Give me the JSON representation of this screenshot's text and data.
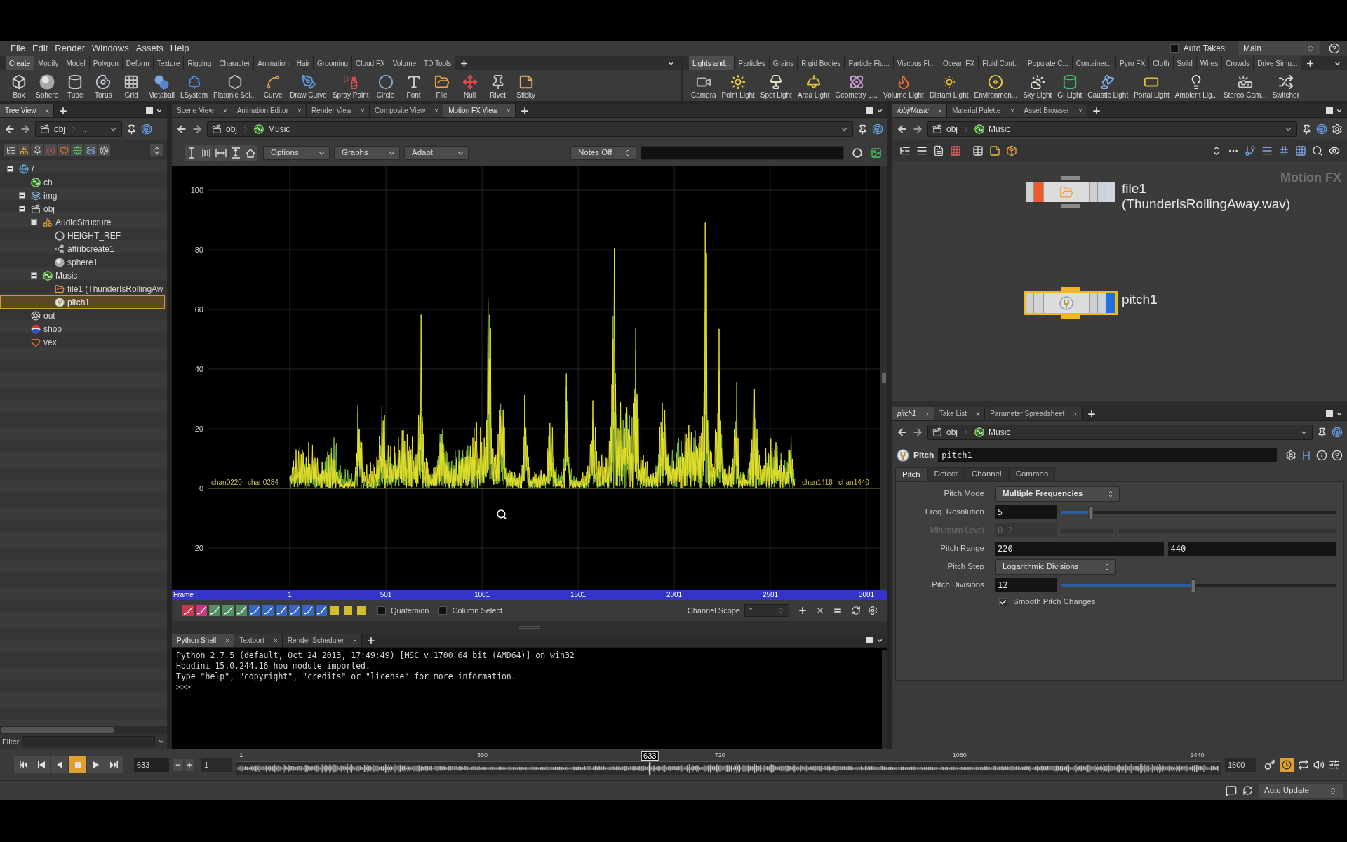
{
  "menu_bar": {
    "items": [
      "File",
      "Edit",
      "Render",
      "Windows",
      "Assets",
      "Help"
    ],
    "auto_takes": {
      "label": "Auto Takes",
      "checked": false
    },
    "desktop": "Main"
  },
  "left_shelf": {
    "tabs": [
      {
        "label": "Create",
        "selected": true
      },
      {
        "label": "Modify",
        "selected": false
      },
      {
        "label": "Model",
        "selected": false
      },
      {
        "label": "Polygon",
        "selected": false
      },
      {
        "label": "Deform",
        "selected": false
      },
      {
        "label": "Texture",
        "selected": false
      },
      {
        "label": "Rigging",
        "selected": false
      },
      {
        "label": "Character",
        "selected": false
      },
      {
        "label": "Animation",
        "selected": false
      },
      {
        "label": "Hair",
        "selected": false
      },
      {
        "label": "Grooming",
        "selected": false
      },
      {
        "label": "Cloud FX",
        "selected": false
      },
      {
        "label": "Volume",
        "selected": false
      },
      {
        "label": "TD Tools",
        "selected": false
      }
    ],
    "tools": [
      {
        "label": "Box",
        "kind": "box"
      },
      {
        "label": "Sphere",
        "kind": "sphere"
      },
      {
        "label": "Tube",
        "kind": "tube"
      },
      {
        "label": "Torus",
        "kind": "torus"
      },
      {
        "label": "Grid",
        "kind": "grid"
      },
      {
        "label": "Metaball",
        "kind": "metaball"
      },
      {
        "label": "LSystem",
        "kind": "lsystem"
      },
      {
        "label": "Platonic Sol...",
        "kind": "platonic"
      },
      {
        "label": "Curve",
        "kind": "curve"
      },
      {
        "label": "Draw Curve",
        "kind": "drawcurve"
      },
      {
        "label": "Spray Paint",
        "kind": "spraypaint"
      },
      {
        "label": "Circle",
        "kind": "circle"
      },
      {
        "label": "Font",
        "kind": "font"
      },
      {
        "label": "File",
        "kind": "file"
      },
      {
        "label": "Null",
        "kind": "null"
      },
      {
        "label": "Rivet",
        "kind": "rivet"
      },
      {
        "label": "Sticky",
        "kind": "sticky"
      }
    ]
  },
  "right_shelf": {
    "tabs": [
      {
        "label": "Lights and...",
        "selected": true
      },
      {
        "label": "Particles",
        "selected": false
      },
      {
        "label": "Grains",
        "selected": false
      },
      {
        "label": "Rigid Bodies",
        "selected": false
      },
      {
        "label": "Particle Flu...",
        "selected": false
      },
      {
        "label": "Viscous Fl...",
        "selected": false
      },
      {
        "label": "Ocean FX",
        "selected": false
      },
      {
        "label": "Fluid Cont...",
        "selected": false
      },
      {
        "label": "Populate C...",
        "selected": false
      },
      {
        "label": "Container...",
        "selected": false
      },
      {
        "label": "Pyro FX",
        "selected": false
      },
      {
        "label": "Cloth",
        "selected": false
      },
      {
        "label": "Solid",
        "selected": false
      },
      {
        "label": "Wires",
        "selected": false
      },
      {
        "label": "Crowds",
        "selected": false
      },
      {
        "label": "Drive Simu...",
        "selected": false
      }
    ],
    "tools": [
      {
        "label": "Camera",
        "kind": "camera"
      },
      {
        "label": "Point Light",
        "kind": "pointlight"
      },
      {
        "label": "Spot Light",
        "kind": "spotlight"
      },
      {
        "label": "Area Light",
        "kind": "arealight"
      },
      {
        "label": "Geometry L...",
        "kind": "geolight"
      },
      {
        "label": "Volume Light",
        "kind": "volumelight"
      },
      {
        "label": "Distant Light",
        "kind": "distantlight"
      },
      {
        "label": "Environmen...",
        "kind": "envlight"
      },
      {
        "label": "Sky Light",
        "kind": "skylight"
      },
      {
        "label": "GI Light",
        "kind": "gilight"
      },
      {
        "label": "Caustic Light",
        "kind": "causticlight"
      },
      {
        "label": "Portal Light",
        "kind": "portallight"
      },
      {
        "label": "Ambient Lig...",
        "kind": "ambientlight"
      },
      {
        "label": "Stereo Cam...",
        "kind": "stereocam"
      },
      {
        "label": "Switcher",
        "kind": "switcher"
      }
    ]
  },
  "tree_view": {
    "tabs": [
      {
        "label": "Tree View",
        "selected": true
      }
    ],
    "path": [
      {
        "label": "obj",
        "kind": "objects"
      },
      {
        "label": "...",
        "kind": "more"
      }
    ],
    "nodes": [
      {
        "label": "/",
        "kind": "root",
        "expanded": true,
        "selected": false,
        "children": [
          {
            "label": "ch",
            "kind": "chopnet",
            "selected": false
          },
          {
            "label": "img",
            "kind": "images",
            "expanded": false,
            "selected": false
          },
          {
            "label": "obj",
            "kind": "objects",
            "expanded": true,
            "selected": false,
            "children": [
              {
                "label": "AudioStructure",
                "kind": "subnet",
                "expanded": true,
                "selected": false,
                "children": [
                  {
                    "label": "HEIGHT_REF",
                    "kind": "null",
                    "selected": false
                  },
                  {
                    "label": "attribcreate1",
                    "kind": "attribute",
                    "selected": false
                  },
                  {
                    "label": "sphere1",
                    "kind": "sphere",
                    "selected": false
                  }
                ]
              },
              {
                "label": "Music",
                "kind": "chopnet",
                "expanded": true,
                "selected": false,
                "children": [
                  {
                    "label": "file1 (ThunderIsRollingAw",
                    "kind": "file",
                    "selected": false
                  },
                  {
                    "label": "pitch1",
                    "kind": "pitch",
                    "selected": true
                  }
                ]
              }
            ]
          },
          {
            "label": "out",
            "kind": "outputs",
            "selected": false
          },
          {
            "label": "shop",
            "kind": "shaders",
            "selected": false
          },
          {
            "label": "vex",
            "kind": "vex",
            "selected": false
          }
        ]
      }
    ],
    "filter": {
      "label": "Filter"
    }
  },
  "motion_view": {
    "tabs": [
      {
        "label": "Scene View",
        "selected": false
      },
      {
        "label": "Animation Editor",
        "selected": false
      },
      {
        "label": "Render View",
        "selected": false
      },
      {
        "label": "Composite View",
        "selected": false
      },
      {
        "label": "Motion FX View",
        "selected": true
      }
    ],
    "path": [
      {
        "label": "obj",
        "kind": "objects"
      },
      {
        "label": "Music",
        "kind": "chopnet"
      }
    ],
    "menus": [
      "Options",
      "Graphs",
      "Adapt"
    ],
    "notes": "Notes Off",
    "graph": {
      "y_ticks": [
        "100",
        "80",
        "60",
        "40",
        "20",
        "0",
        "-20"
      ],
      "channel_labels": {
        "start": [
          "chan0220",
          "chan0284"
        ],
        "end": [
          "chan1418",
          "chan1440"
        ]
      },
      "frame_label": "Frame",
      "x_ticks": [
        "1",
        "501",
        "1001",
        "1501",
        "2001",
        "2501",
        "3001"
      ]
    },
    "options": [
      {
        "label": "Quaternion",
        "checked": false
      },
      {
        "label": "Column Select",
        "checked": false
      }
    ],
    "channel_scope": {
      "label": "Channel Scope",
      "value": "*"
    }
  },
  "python_shell": {
    "tabs": [
      {
        "label": "Python Shell",
        "selected": true
      },
      {
        "label": "Textport",
        "selected": false
      },
      {
        "label": "Render Scheduler",
        "selected": false
      }
    ],
    "lines": [
      "Python 2.7.5 (default, Oct 24 2013, 17:49:49) [MSC v.1700 64 bit (AMD64)] on win32",
      "Houdini 15.0.244.16 hou module imported.",
      "Type \"help\", \"copyright\", \"credits\" or \"license\" for more information.",
      ">>>"
    ]
  },
  "network_editor": {
    "tabs": [
      {
        "label": "/obj/Music",
        "selected": true
      },
      {
        "label": "Material Palette",
        "selected": false
      },
      {
        "label": "Asset Browser",
        "selected": false
      }
    ],
    "path": [
      {
        "label": "obj",
        "kind": "objects"
      },
      {
        "label": "Music",
        "kind": "chopnet"
      }
    ],
    "context": "Motion FX",
    "nodes": [
      {
        "name": "file1",
        "detail": "(ThunderIsRollingAway.wav)",
        "kind": "file",
        "selected": false,
        "locked": true,
        "display": false
      },
      {
        "name": "pitch1",
        "kind": "pitch",
        "selected": true,
        "locked": false,
        "display": true
      }
    ]
  },
  "parameters": {
    "tabs": [
      {
        "label": "pitch1",
        "selected": true
      },
      {
        "label": "Take List",
        "selected": false
      },
      {
        "label": "Parameter Spreadsheet",
        "selected": false
      }
    ],
    "path": [
      {
        "label": "obj",
        "kind": "objects"
      },
      {
        "label": "Music",
        "kind": "chopnet"
      }
    ],
    "type": "Pitch",
    "name": "pitch1",
    "sections": [
      {
        "label": "Pitch",
        "selected": true
      },
      {
        "label": "Detect",
        "selected": false
      },
      {
        "label": "Channel",
        "selected": false
      },
      {
        "label": "Common",
        "selected": false
      }
    ],
    "rows": [
      {
        "kind": "menu",
        "label": "Pitch Mode",
        "value": "Multiple Frequencies",
        "modified": true,
        "disabled": false
      },
      {
        "kind": "slider",
        "label": "Freq. Resolution",
        "value": "5",
        "level": 0.11,
        "modified": false,
        "disabled": false
      },
      {
        "kind": "slider",
        "label": "Minimum Level",
        "value": "0.2",
        "level": 0.2,
        "modified": false,
        "disabled": true
      },
      {
        "kind": "pair",
        "label": "Pitch Range",
        "values": [
          "220",
          "440"
        ],
        "modified": false,
        "disabled": false
      },
      {
        "kind": "menu",
        "label": "Pitch Step",
        "value": "Logarithmic Divisions",
        "modified": false,
        "disabled": false
      },
      {
        "kind": "slider",
        "label": "Pitch Divisions",
        "value": "12",
        "level": 0.48,
        "modified": false,
        "disabled": false
      },
      {
        "kind": "checkbox",
        "label": "Smooth Pitch Changes",
        "checked": true,
        "modified": false,
        "disabled": false
      }
    ]
  },
  "playbar": {
    "transport": [
      {
        "kind": "first",
        "selected": false
      },
      {
        "kind": "prev_key",
        "selected": false
      },
      {
        "kind": "reverse",
        "selected": false
      },
      {
        "kind": "stop",
        "selected": true
      },
      {
        "kind": "play",
        "selected": false
      },
      {
        "kind": "last",
        "selected": false
      }
    ],
    "frame": "633",
    "start": "1",
    "ticks": [
      "1",
      "360",
      "720",
      "1080",
      "1440"
    ],
    "marker": "633",
    "level": 0.42,
    "end": "1500"
  },
  "status_bar": {
    "update_mode": "Auto Update"
  }
}
